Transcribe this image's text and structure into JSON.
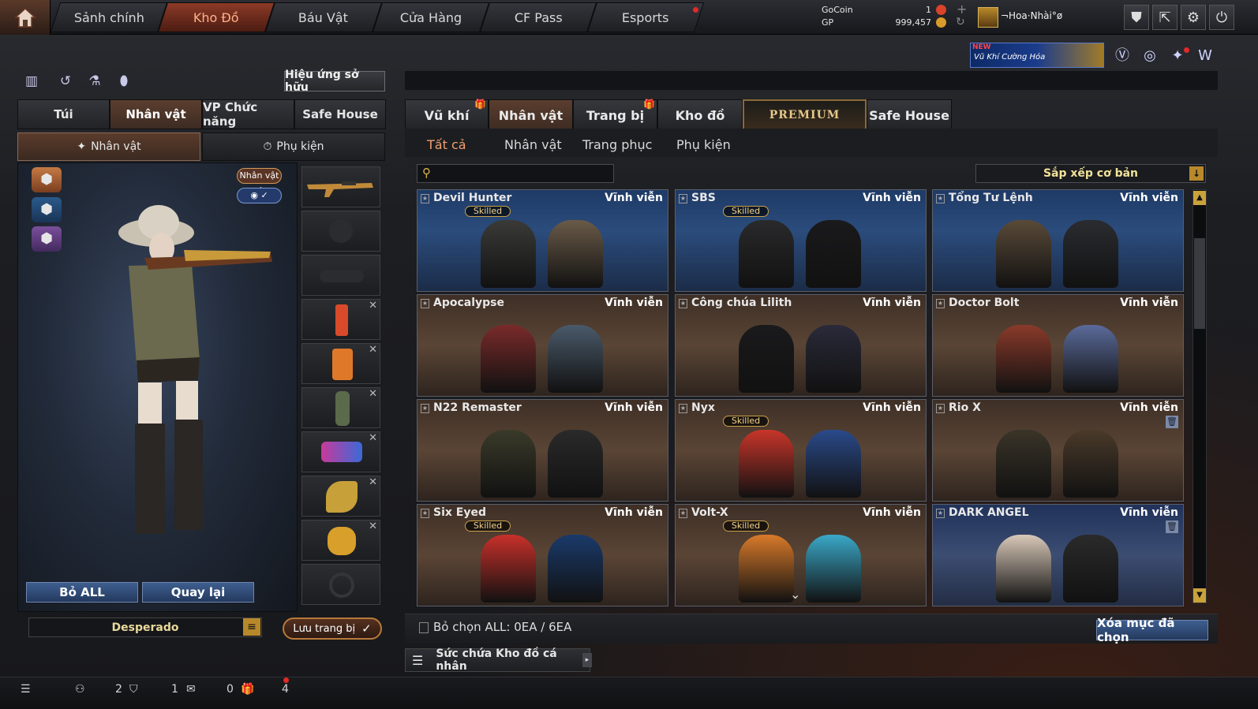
{
  "topnav": {
    "tabs": [
      {
        "label": "Sảnh chính"
      },
      {
        "label": "Kho Đồ"
      },
      {
        "label": "Báu Vật"
      },
      {
        "label": "Cửa Hàng"
      },
      {
        "label": "CF Pass"
      },
      {
        "label": "Esports"
      }
    ],
    "active_tab": "Kho Đồ",
    "gocoin_label": "GoCoin",
    "gp_label": "GP",
    "gocoin_value": "1",
    "gp_value": "999,457",
    "username": "¬Hoa·Nhài°ø"
  },
  "promo": {
    "badge": "NEW",
    "title": "Vũ Khí Cường Hóa"
  },
  "left": {
    "owned_effects_button": "Hiệu ứng sở hữu",
    "tabs": [
      {
        "label": "Túi"
      },
      {
        "label": "Nhân vật"
      },
      {
        "label": "VP Chức năng"
      },
      {
        "label": "Safe House"
      }
    ],
    "subtabs": [
      {
        "label": "Nhân vật"
      },
      {
        "label": "Phụ kiện"
      }
    ],
    "char_badge": "Nhân vật ✓",
    "remove_all": "Bỏ ALL",
    "go_back": "Quay lại",
    "preset_name": "Desperado",
    "save_loadout": "Lưu trang bị"
  },
  "right": {
    "tabs": [
      {
        "label": "Vũ khí"
      },
      {
        "label": "Nhân vật"
      },
      {
        "label": "Trang bị"
      },
      {
        "label": "Kho đồ"
      },
      {
        "label": "PREMIUM"
      },
      {
        "label": "Safe House"
      }
    ],
    "filters": [
      {
        "label": "Tất cả"
      },
      {
        "label": "Nhân vật"
      },
      {
        "label": "Trang phục"
      },
      {
        "label": "Phụ kiện"
      }
    ],
    "search_placeholder": "",
    "sort_label": "Sắp xếp cơ bản",
    "cards": [
      {
        "name": "Devil Hunter",
        "duration": "Vĩnh viễn",
        "skilled": "Skilled",
        "theme": "blue"
      },
      {
        "name": "SBS",
        "duration": "Vĩnh viễn",
        "skilled": "Skilled",
        "theme": "blue"
      },
      {
        "name": "Tổng Tư Lệnh",
        "duration": "Vĩnh viễn",
        "skilled": "",
        "theme": "blue"
      },
      {
        "name": "Apocalypse",
        "duration": "Vĩnh viễn",
        "skilled": "",
        "theme": "brown"
      },
      {
        "name": "Công chúa Lilith",
        "duration": "Vĩnh viễn",
        "skilled": "",
        "theme": "brown"
      },
      {
        "name": "Doctor Bolt",
        "duration": "Vĩnh viễn",
        "skilled": "",
        "theme": "brown"
      },
      {
        "name": "N22 Remaster",
        "duration": "Vĩnh viễn",
        "skilled": "",
        "theme": "brown"
      },
      {
        "name": "Nyx",
        "duration": "Vĩnh viễn",
        "skilled": "Skilled",
        "theme": "brown"
      },
      {
        "name": "Rio X",
        "duration": "Vĩnh viễn",
        "skilled": "",
        "theme": "brown"
      },
      {
        "name": "Six Eyed",
        "duration": "Vĩnh viễn",
        "skilled": "Skilled",
        "theme": "brown"
      },
      {
        "name": "Volt-X",
        "duration": "Vĩnh viễn",
        "skilled": "Skilled",
        "theme": "brown"
      },
      {
        "name": "DARK ANGEL",
        "duration": "Vĩnh viễn",
        "skilled": "",
        "theme": "blue2"
      }
    ],
    "deselect_all": "Bỏ chọn ALL: 0EA / 6EA",
    "delete_selected": "Xóa mục đã chọn",
    "capacity": "Sức chứa Kho đồ cá nhân"
  },
  "statusbar": {
    "count_a": "2",
    "count_b": "1",
    "count_c": "0",
    "count_d": "4"
  },
  "colors": {
    "accent": "#b87a3a",
    "active_tab": "#8c3a26",
    "button_blue": "#3e5e8f",
    "sort_gold": "#f0e29a"
  }
}
